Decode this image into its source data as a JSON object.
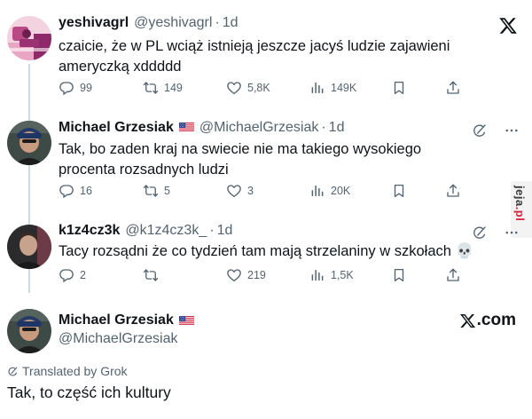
{
  "tweets": [
    {
      "name": "yeshivagrl",
      "handle": "@yeshivagrl",
      "dot": "·",
      "time": "1d",
      "body": "czaicie, że w PL wciąż istnieją jeszcze jacyś ludzie zajawieni ameryczką xddddd",
      "replies": "99",
      "retweets": "149",
      "likes": "5,8K",
      "views": "149K"
    },
    {
      "name": "Michael Grzesiak",
      "handle": "@MichaelGrzesiak",
      "dot": "·",
      "time": "1d",
      "body": "Tak, bo zaden kraj na swiecie nie ma takiego wysokiego procenta rozsadnych ludzi",
      "replies": "16",
      "retweets": "5",
      "likes": "3",
      "views": "20K"
    },
    {
      "name": "k1z4cz3k",
      "handle": "@k1z4cz3k_",
      "dot": "·",
      "time": "1d",
      "body": "Tacy rozsądni że co tydzień tam mają strzelaniny w szkołach 💀",
      "replies": "2",
      "retweets": "",
      "likes": "219",
      "views": "1,5K"
    }
  ],
  "main_tweet": {
    "name": "Michael Grzesiak",
    "handle": "@MichaelGrzesiak",
    "site_label": ".com",
    "translated_label": "Translated by Grok",
    "body": "Tak, to część ich kultury"
  },
  "watermark": {
    "text": "jeja",
    "suffix": ".pl"
  },
  "icons": {
    "brand": "x-logo-icon",
    "reply": "reply-icon",
    "retweet": "retweet-icon",
    "like": "heart-icon",
    "views": "views-icon",
    "bookmark": "bookmark-icon",
    "share": "share-icon",
    "grok": "grok-icon",
    "more": "more-icon",
    "flag": "us-flag-icon"
  },
  "colors": {
    "text": "#0f1419",
    "secondary": "#536471",
    "thread_line": "#cfd9de",
    "watermark_accent": "#d8213b"
  }
}
